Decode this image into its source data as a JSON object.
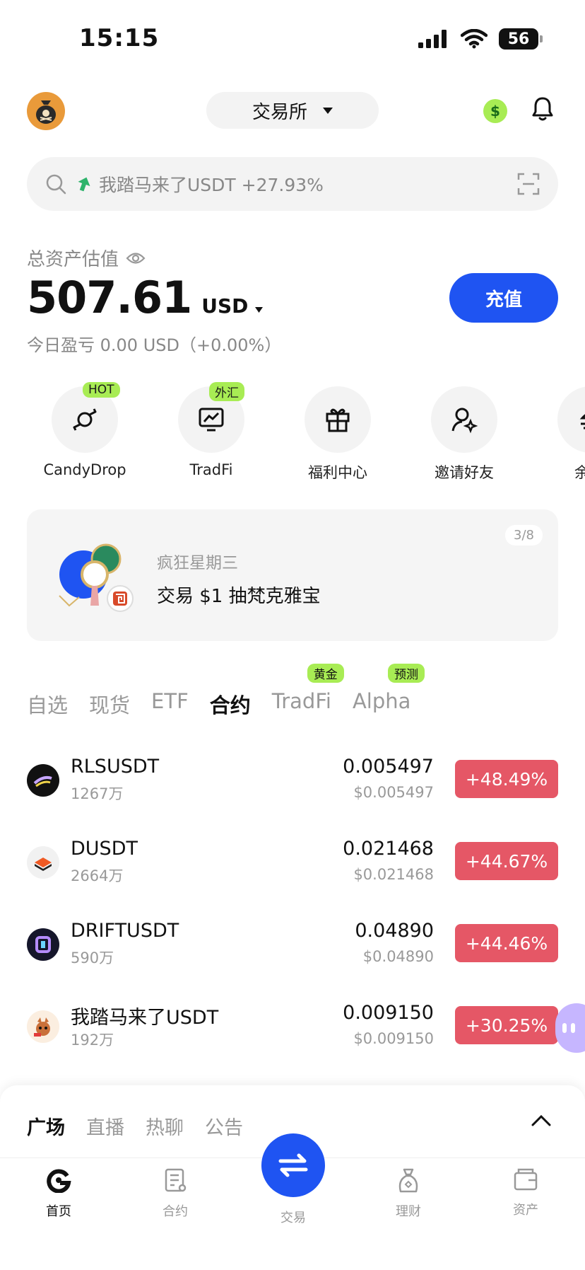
{
  "status_bar": {
    "time": "15:15",
    "battery": "56"
  },
  "header": {
    "exchange_label": "交易所"
  },
  "search": {
    "text": "我踏马来了USDT +27.93%"
  },
  "assets": {
    "label": "总资产估值",
    "value": "507.61",
    "currency": "USD",
    "pnl": "今日盈亏 0.00 USD（+0.00%）",
    "deposit_label": "充值"
  },
  "quick_actions": [
    {
      "label": "CandyDrop",
      "badge": "HOT",
      "icon": "candy-icon"
    },
    {
      "label": "TradFi",
      "badge": "外汇",
      "icon": "chart-monitor-icon"
    },
    {
      "label": "福利中心",
      "badge": "",
      "icon": "gift-icon"
    },
    {
      "label": "邀请好友",
      "badge": "",
      "icon": "invite-user-icon"
    },
    {
      "label": "余币宝",
      "badge": "",
      "icon": "savings-icon"
    }
  ],
  "banner": {
    "subtitle": "疯狂星期三",
    "title": "交易 $1 抽梵克雅宝",
    "page": "3/8"
  },
  "market_tabs": [
    {
      "label": "自选",
      "badge": ""
    },
    {
      "label": "现货",
      "badge": ""
    },
    {
      "label": "ETF",
      "badge": ""
    },
    {
      "label": "合约",
      "badge": ""
    },
    {
      "label": "TradFi",
      "badge": "黄金"
    },
    {
      "label": "Alpha",
      "badge": "预测"
    }
  ],
  "markets": [
    {
      "symbol": "RLSUSDT",
      "volume": "1267万",
      "price": "0.005497",
      "price_usd": "$0.005497",
      "change": "+48.49%"
    },
    {
      "symbol": "DUSDT",
      "volume": "2664万",
      "price": "0.021468",
      "price_usd": "$0.021468",
      "change": "+44.67%"
    },
    {
      "symbol": "DRIFTUSDT",
      "volume": "590万",
      "price": "0.04890",
      "price_usd": "$0.04890",
      "change": "+44.46%"
    },
    {
      "symbol": "我踏马来了USDT",
      "volume": "192万",
      "price": "0.009150",
      "price_usd": "$0.009150",
      "change": "+30.25%"
    }
  ],
  "feed_tabs": [
    "广场",
    "直播",
    "热聊",
    "公告"
  ],
  "bottom_nav": [
    {
      "label": "首页",
      "icon": "home-icon"
    },
    {
      "label": "合约",
      "icon": "contract-icon"
    },
    {
      "label": "交易",
      "icon": "trade-swap-icon"
    },
    {
      "label": "理财",
      "icon": "finance-bag-icon"
    },
    {
      "label": "资产",
      "icon": "wallet-icon"
    }
  ],
  "colors": {
    "accent": "#1f54f2",
    "up": "#e55766",
    "badge": "#a8ec54"
  }
}
